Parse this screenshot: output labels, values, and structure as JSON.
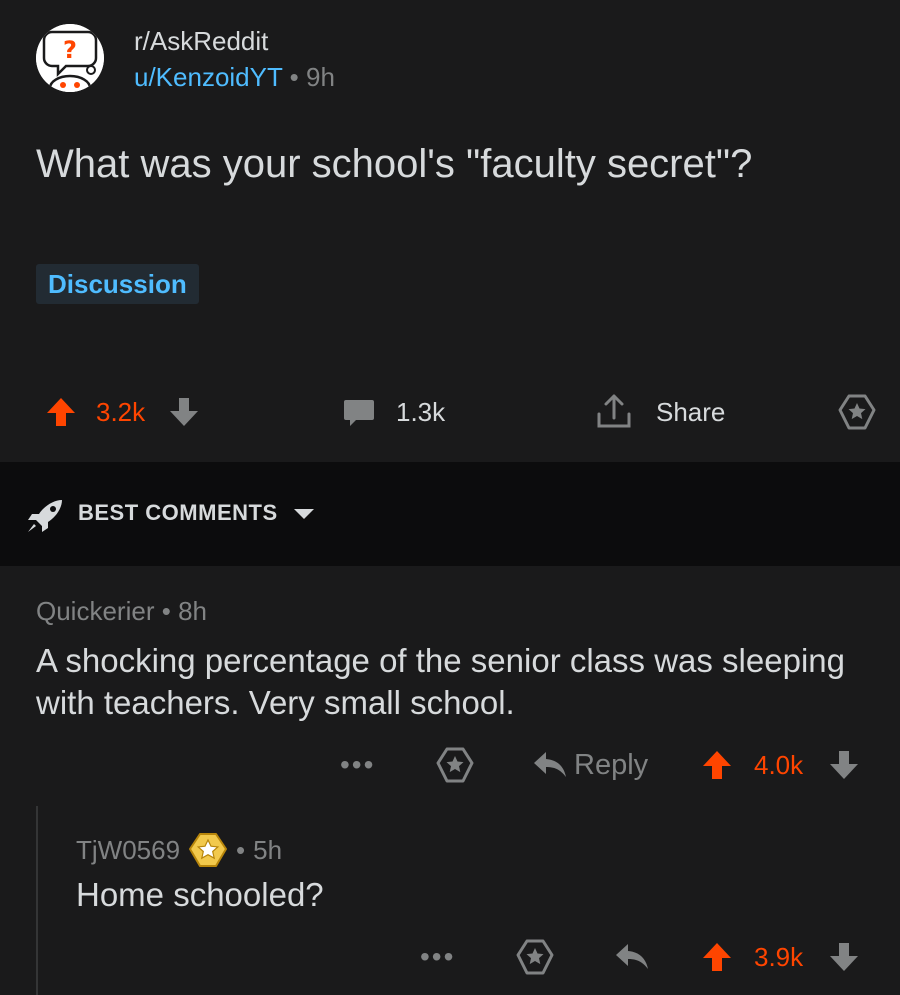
{
  "post": {
    "subreddit": "r/AskReddit",
    "author": "u/KenzoidYT",
    "separator": "•",
    "age": "9h",
    "title": "What was your school's \"faculty secret\"?",
    "flair": "Discussion",
    "upvotes": "3.2k",
    "comments_count": "1.3k",
    "share_label": "Share"
  },
  "sort": {
    "label": "BEST COMMENTS"
  },
  "comments": [
    {
      "author": "Quickerier",
      "separator": "•",
      "age": "8h",
      "body": "A shocking percentage of the senior class was sleeping with teachers. Very small school.",
      "more": "•••",
      "reply_label": "Reply",
      "score": "4.0k"
    },
    {
      "author": "TjW0569",
      "separator": "•",
      "age": "5h",
      "body": "Home schooled?",
      "more": "•••",
      "score": "3.9k"
    }
  ],
  "colors": {
    "upvote": "#ff4500",
    "link": "#4fbcff",
    "muted": "#818384",
    "text": "#d7dadc"
  }
}
